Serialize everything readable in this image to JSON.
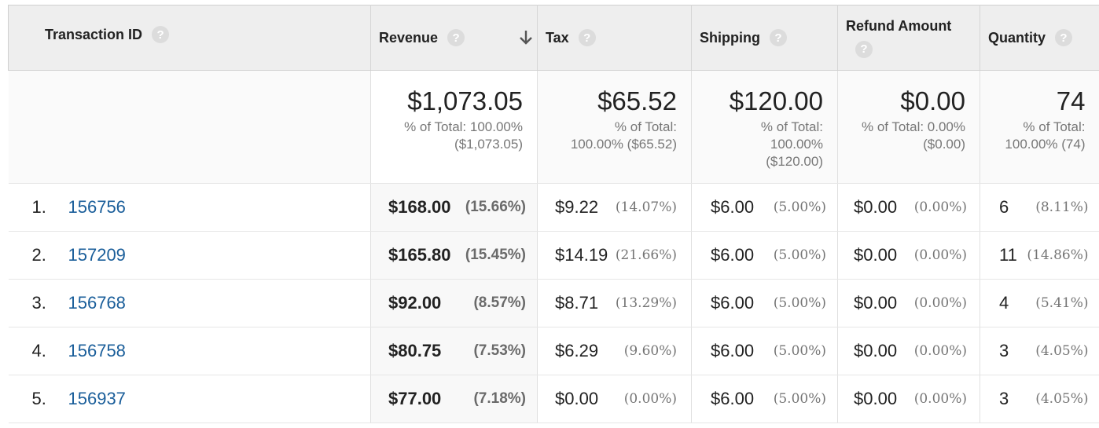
{
  "columns": {
    "transaction_id": "Transaction ID",
    "revenue": "Revenue",
    "tax": "Tax",
    "shipping": "Shipping",
    "refund_amount": "Refund Amount",
    "quantity": "Quantity",
    "help_glyph": "?"
  },
  "totals": {
    "revenue": {
      "value": "$1,073.05",
      "sub1": "% of Total: 100.00%",
      "sub2": "($1,073.05)"
    },
    "tax": {
      "value": "$65.52",
      "sub1": "% of Total:",
      "sub2": "100.00% ($65.52)"
    },
    "shipping": {
      "value": "$120.00",
      "sub1": "% of Total:",
      "sub2": "100.00%",
      "sub3": "($120.00)"
    },
    "refund": {
      "value": "$0.00",
      "sub1": "% of Total: 0.00%",
      "sub2": "($0.00)"
    },
    "quantity": {
      "value": "74",
      "sub1": "% of Total:",
      "sub2": "100.00% (74)"
    }
  },
  "rows": [
    {
      "index": "1.",
      "id": "156756",
      "revenue": "$168.00",
      "revenue_pct": "(15.66%)",
      "tax": "$9.22",
      "tax_pct": "(14.07%)",
      "shipping": "$6.00",
      "shipping_pct": "(5.00%)",
      "refund": "$0.00",
      "refund_pct": "(0.00%)",
      "quantity": "6",
      "quantity_pct": "(8.11%)"
    },
    {
      "index": "2.",
      "id": "157209",
      "revenue": "$165.80",
      "revenue_pct": "(15.45%)",
      "tax": "$14.19",
      "tax_pct": "(21.66%)",
      "shipping": "$6.00",
      "shipping_pct": "(5.00%)",
      "refund": "$0.00",
      "refund_pct": "(0.00%)",
      "quantity": "11",
      "quantity_pct": "(14.86%)"
    },
    {
      "index": "3.",
      "id": "156768",
      "revenue": "$92.00",
      "revenue_pct": "(8.57%)",
      "tax": "$8.71",
      "tax_pct": "(13.29%)",
      "shipping": "$6.00",
      "shipping_pct": "(5.00%)",
      "refund": "$0.00",
      "refund_pct": "(0.00%)",
      "quantity": "4",
      "quantity_pct": "(5.41%)"
    },
    {
      "index": "4.",
      "id": "156758",
      "revenue": "$80.75",
      "revenue_pct": "(7.53%)",
      "tax": "$6.29",
      "tax_pct": "(9.60%)",
      "shipping": "$6.00",
      "shipping_pct": "(5.00%)",
      "refund": "$0.00",
      "refund_pct": "(0.00%)",
      "quantity": "3",
      "quantity_pct": "(4.05%)"
    },
    {
      "index": "5.",
      "id": "156937",
      "revenue": "$77.00",
      "revenue_pct": "(7.18%)",
      "tax": "$0.00",
      "tax_pct": "(0.00%)",
      "shipping": "$6.00",
      "shipping_pct": "(5.00%)",
      "refund": "$0.00",
      "refund_pct": "(0.00%)",
      "quantity": "3",
      "quantity_pct": "(4.05%)"
    }
  ],
  "colors": {
    "link": "#1a5e9a",
    "header_bg": "#eeeeee",
    "help_icon": "#dcdcdc"
  },
  "icons": {
    "help": "help-icon",
    "sort": "sort-descending-icon"
  }
}
